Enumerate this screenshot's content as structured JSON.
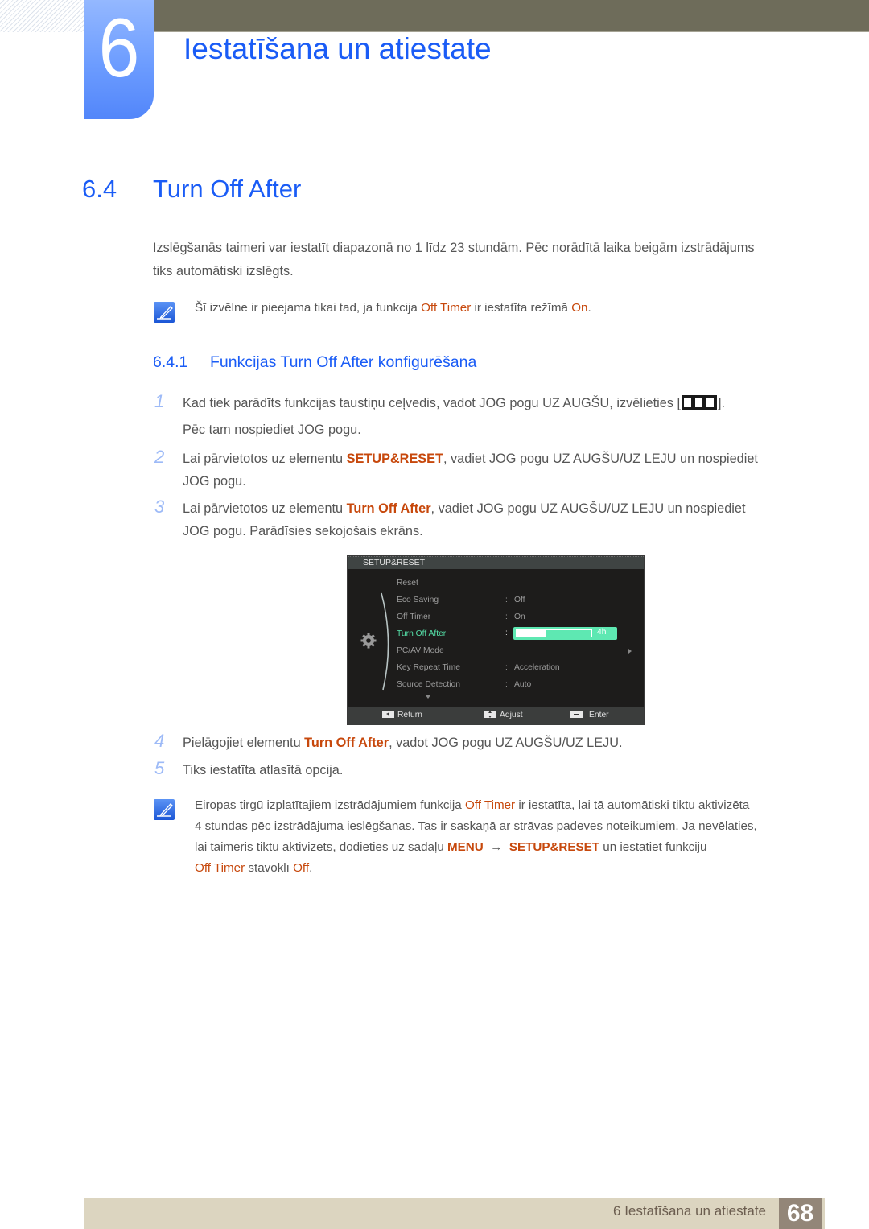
{
  "header": {
    "chapter_number": "6",
    "chapter_title": "Iestatīšana un atiestate"
  },
  "section": {
    "number": "6.4",
    "title": "Turn Off After",
    "intro_line1": "Izslēgšanās taimeri var iestatīt diapazonā no 1 līdz 23 stundām. Pēc norādītā laika beigām izstrādājums",
    "intro_line2": "tiks automātiski izslēgts.",
    "note1": {
      "icon": "note-pencil-icon",
      "pre": "Šī izvēlne ir pieejama tikai tad, ja funkcija ",
      "hl1": "Off Timer",
      "mid": " ir iestatīta režīmā ",
      "hl2": "On",
      "post": "."
    }
  },
  "subsection": {
    "number": "6.4.1",
    "title": "Funkcijas Turn Off After konfigurēšana"
  },
  "steps": [
    {
      "num": "1",
      "line1_pre": "Kad tiek parādīts funkcijas taustiņu ceļvedis, vadot JOG pogu UZ AUGŠU, izvēlieties [",
      "line1_icon": "menu-bars-icon",
      "line1_post": "].",
      "line2": "Pēc tam nospiediet JOG pogu."
    },
    {
      "num": "2",
      "pre": "Lai pārvietotos uz elementu ",
      "hl": "SETUP&RESET",
      "post": ", vadiet JOG pogu UZ AUGŠU/UZ LEJU un nospiediet",
      "line2": "JOG pogu."
    },
    {
      "num": "3",
      "pre": "Lai pārvietotos uz elementu ",
      "hl": "Turn Off After",
      "post": ", vadiet JOG pogu UZ AUGŠU/UZ LEJU un nospiediet",
      "line2": "JOG pogu. Parādīsies sekojošais ekrāns."
    },
    {
      "num": "4",
      "pre": "Pielāgojiet elementu ",
      "hl": "Turn Off After",
      "post": ", vadot JOG pogu UZ AUGŠU/UZ LEJU."
    },
    {
      "num": "5",
      "text": "Tiks iestatīta atlasītā opcija."
    }
  ],
  "osd": {
    "title": "SETUP&RESET",
    "items": [
      {
        "label": "Reset",
        "value": ""
      },
      {
        "label": "Eco Saving",
        "value": "Off"
      },
      {
        "label": "Off Timer",
        "value": "On"
      },
      {
        "label": "Turn Off After",
        "value": "4h",
        "active": true
      },
      {
        "label": "PC/AV Mode",
        "value": ""
      },
      {
        "label": "Key Repeat Time",
        "value": "Acceleration"
      },
      {
        "label": "Source Detection",
        "value": "Auto"
      }
    ],
    "slider": {
      "value_hours": 4,
      "min_hours": 1,
      "max_hours": 23,
      "fill_fraction": 0.4
    },
    "footer": {
      "return": "Return",
      "adjust": "Adjust",
      "enter": "Enter"
    },
    "colors": {
      "active": "#55e0a8",
      "slider": "#5ee8b2"
    }
  },
  "note2": {
    "l1_pre": "Eiropas tirgū izplatītajiem izstrādājumiem funkcija ",
    "l1_hl": "Off Timer",
    "l1_post": " ir iestatīta, lai tā automātiski tiktu aktivizēta",
    "l2": "4 stundas pēc izstrādājuma ieslēgšanas. Tas ir saskaņā ar strāvas padeves noteikumiem. Ja nevēlaties,",
    "l3_pre": "lai taimeris tiktu aktivizēts, dodieties uz sadaļu ",
    "l3_hl1": "MENU",
    "l3_arrow": "→",
    "l3_hl2": "SETUP&RESET",
    "l3_post": " un iestatiet funkciju",
    "l4_hl1": "Off Timer",
    "l4_mid": " stāvoklī ",
    "l4_hl2": "Off",
    "l4_post": "."
  },
  "footer": {
    "text": "6 Iestatīšana un atiestate",
    "page": "68"
  },
  "colors": {
    "heading_blue": "#1a5cf6",
    "highlight_orange": "#c7480c",
    "footer_bg": "#dcd5c0",
    "page_num_bg": "#938678"
  }
}
